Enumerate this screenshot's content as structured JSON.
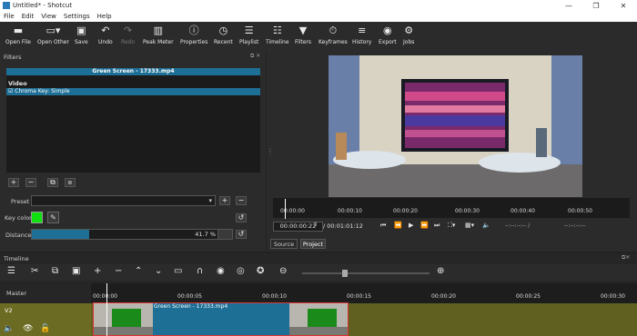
{
  "window": {
    "title": "Untitled* - Shotcut"
  },
  "menu": [
    "File",
    "Edit",
    "View",
    "Settings",
    "Help"
  ],
  "toolbar": [
    {
      "label": "Open File",
      "icon": "folder-icon"
    },
    {
      "label": "Open Other",
      "icon": "folder-open-icon"
    },
    {
      "label": "Save",
      "icon": "save-icon"
    },
    {
      "label": "Undo",
      "icon": "undo-icon"
    },
    {
      "label": "Redo",
      "icon": "redo-icon"
    },
    {
      "label": "Peak Meter",
      "icon": "meter-icon"
    },
    {
      "label": "Properties",
      "icon": "info-icon"
    },
    {
      "label": "Recent",
      "icon": "clock-icon"
    },
    {
      "label": "Playlist",
      "icon": "list-icon"
    },
    {
      "label": "Timeline",
      "icon": "timeline-icon"
    },
    {
      "label": "Filters",
      "icon": "funnel-icon"
    },
    {
      "label": "Keyframes",
      "icon": "stopwatch-icon"
    },
    {
      "label": "History",
      "icon": "history-icon"
    },
    {
      "label": "Export",
      "icon": "disc-icon"
    },
    {
      "label": "Jobs",
      "icon": "gear-icon"
    }
  ],
  "filters": {
    "title": "Filters",
    "clip_name": "Green Screen - 17333.mp4",
    "section": "Video",
    "filter_item": "Chroma Key: Simple",
    "preset_label": "Preset",
    "keycolor_label": "Key color",
    "distance_label": "Distance",
    "distance_value": "41.7 %",
    "distance_fraction": 0.285,
    "key_color": "#10e010"
  },
  "player": {
    "ruler_labels": [
      "00:00:00",
      "00:00:10",
      "00:00:20",
      "00:00:30",
      "00:00:40",
      "00:00:50"
    ],
    "current_tc": "00:00:00:22",
    "total_tc": "/ 00:01:01:12",
    "in_out_a": "--:--:--:-- /",
    "in_out_b": "--:--:--:--",
    "tab_source": "Source",
    "tab_project": "Project"
  },
  "timeline": {
    "title": "Timeline",
    "master": "Master",
    "track": "V2",
    "clip_label": "Green Screen - 17333.mp4",
    "ruler_labels": [
      "00:00:00",
      "00:00:05",
      "00:00:10",
      "00:00:15",
      "00:00:20",
      "00:00:25",
      "00:00:30"
    ]
  },
  "colors": {
    "accent": "#1e6f96",
    "track": "#6b6b23",
    "clip_border": "#dd3333"
  }
}
